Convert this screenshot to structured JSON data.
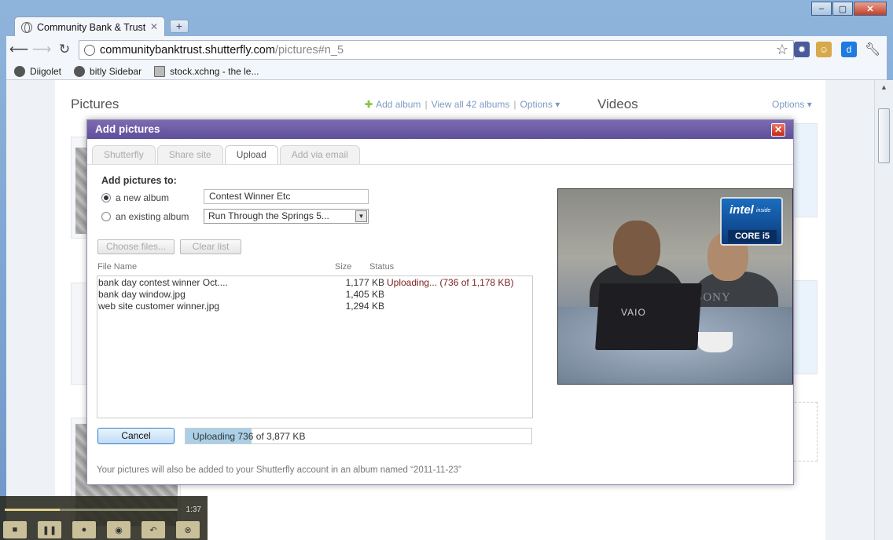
{
  "browser": {
    "tab_title": "Community Bank & Trust",
    "tab_close": "✕",
    "new_tab": "+",
    "url_host": "communitybanktrust.shutterfly.com",
    "url_path": "/pictures#n_5",
    "bookmarks": [
      "Diigolet",
      "bitly Sidebar",
      "stock.xchng - the le..."
    ]
  },
  "page": {
    "pictures_title": "Pictures",
    "add_album": "Add album",
    "view_all": "View all 42 albums",
    "options": "Options",
    "videos_title": "Videos",
    "videos_options": "Options"
  },
  "dialog": {
    "title": "Add pictures",
    "close": "✕",
    "tabs": [
      "Shutterfly",
      "Share site",
      "Upload",
      "Add via email"
    ],
    "active_tab": "Upload",
    "add_to_label": "Add pictures to:",
    "new_album_label": "a new album",
    "existing_album_label": "an existing album",
    "new_album_value": "Contest Winner Etc",
    "existing_album_value": "Run Through the Springs 5...",
    "choose_files": "Choose files...",
    "clear_list": "Clear list",
    "col_file_name": "File Name",
    "col_size": "Size",
    "col_status": "Status",
    "files": [
      {
        "name": "bank day contest winner Oct....",
        "size": "1,177 KB",
        "status": "Uploading... (736 of 1,178 KB)"
      },
      {
        "name": "bank day window.jpg",
        "size": "1,405 KB",
        "status": ""
      },
      {
        "name": "web site customer winner.jpg",
        "size": "1,294 KB",
        "status": ""
      }
    ],
    "cancel": "Cancel",
    "progress_text": "Uploading 736 of 3,877 KB",
    "progress_fraction": 0.19,
    "footnote": "Your pictures will also be added to your Shutterfly account in an album named “2011-11-23”"
  },
  "video_ad": {
    "brand_laptop": "VAIO",
    "brand_shirt": "SONY",
    "intel_word": "intel",
    "intel_inside": "inside",
    "intel_core": "CORE i5"
  },
  "player": {
    "time": "1:37"
  }
}
